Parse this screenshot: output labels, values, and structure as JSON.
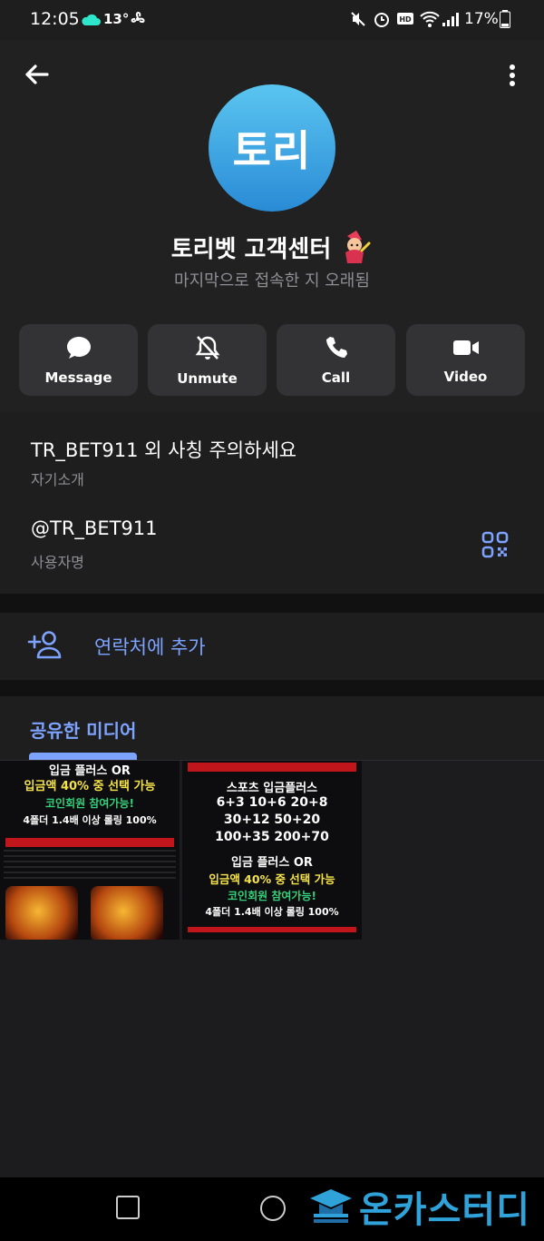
{
  "status_bar": {
    "time": "12:05",
    "temperature": "13°",
    "battery": "17%"
  },
  "profile": {
    "avatar_text": "토리",
    "name": "토리벳 고객센터",
    "last_seen": "마지막으로 접속한 지 오래됨"
  },
  "actions": [
    {
      "label": "Message",
      "icon": "message-icon"
    },
    {
      "label": "Unmute",
      "icon": "bell-off-icon"
    },
    {
      "label": "Call",
      "icon": "phone-icon"
    },
    {
      "label": "Video",
      "icon": "video-icon"
    }
  ],
  "info": {
    "bio": "TR_BET911 외 사칭 주의하세요",
    "bio_caption": "자기소개",
    "username": "@TR_BET911",
    "username_caption": "사용자명"
  },
  "add_contact": {
    "label": "연락처에 추가"
  },
  "shared_media": {
    "label": "공유한 미디어",
    "items": [
      {
        "lines": [
          "입금 플러스 OR",
          "입금액 40% 중 선택 가능",
          "코인회원 참여가능!",
          "4폴더 1.4배 이상 롤링 100%"
        ]
      },
      {
        "lines": [
          "스포츠 입금플러스",
          "6+3 10+6 20+8",
          "30+12 50+20",
          "100+35 200+70",
          "입금 플러스 OR",
          "입금액 40% 중 선택 가능",
          "코인회원 참여가능!",
          "4폴더 1.4배 이상 롤링 100%"
        ]
      }
    ]
  },
  "watermark": {
    "text": "온카스터디"
  },
  "colors": {
    "accent": "#7da3ff",
    "avatar_top": "#5ac5f0",
    "avatar_bottom": "#2a8bd6",
    "button_bg": "#333335",
    "background": "#1c1c1e"
  }
}
